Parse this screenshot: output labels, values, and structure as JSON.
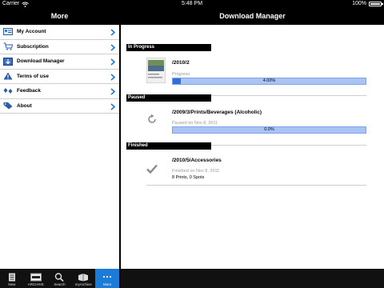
{
  "statusbar": {
    "carrier": "Carrier",
    "time": "5:48 PM",
    "battery": "100%"
  },
  "left": {
    "title": "More",
    "items": [
      {
        "label": "My Account",
        "icon": "id-card-icon"
      },
      {
        "label": "Subscription",
        "icon": "cart-icon"
      },
      {
        "label": "Download Manager",
        "icon": "download-icon"
      },
      {
        "label": "Terms of use",
        "icon": "warning-icon"
      },
      {
        "label": "Feedback",
        "icon": "feedback-icon"
      },
      {
        "label": "About",
        "icon": "tag-icon"
      }
    ],
    "tabs": [
      {
        "label": "New",
        "icon": "new-icon"
      },
      {
        "label": "ARCHIVE",
        "icon": "archive-icon"
      },
      {
        "label": "Search",
        "icon": "search-icon"
      },
      {
        "label": "myArchive",
        "icon": "my-archive-icon"
      },
      {
        "label": "More",
        "icon": "more-dots-icon",
        "active": true
      }
    ]
  },
  "right": {
    "title": "Download Manager",
    "sections": [
      {
        "header": "In Progress",
        "path": "/2010/2",
        "status": "Progress:",
        "progress": 0.04,
        "progress_text": "4.00%"
      },
      {
        "header": "Paused",
        "path": "/2009/3/Prints/Beverages (Alcoholic)",
        "status": "Paused on Nov 8, 2011",
        "progress": 0.0,
        "progress_text": "0.0%"
      },
      {
        "header": "Finished",
        "path": "/2010/5/Accessories",
        "status": "Finished on Nov 8, 2011",
        "detail": "8 Prints, 0 Spots"
      }
    ]
  },
  "colors": {
    "accent": "#1a7bd8",
    "progress_fill": "#2e6fe0",
    "progress_track": "#a9c4f2"
  }
}
